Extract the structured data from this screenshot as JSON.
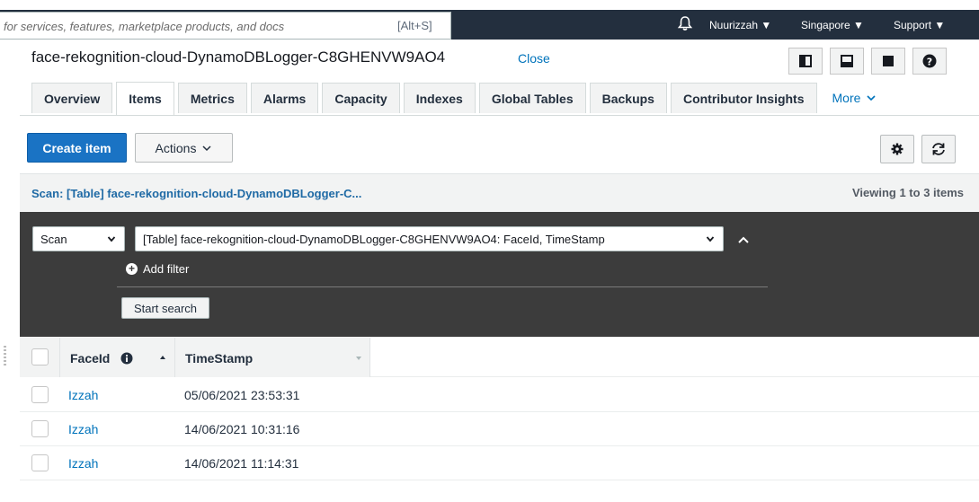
{
  "topnav": {
    "search_placeholder": "for services, features, marketplace products, and docs",
    "search_shortcut": "[Alt+S]",
    "user": "Nuurizzah ▼",
    "region": "Singapore ▼",
    "support": "Support ▼"
  },
  "header": {
    "title": "face-rekognition-cloud-DynamoDBLogger-C8GHENVW9AO4",
    "close": "Close"
  },
  "tabs": [
    {
      "label": "Overview"
    },
    {
      "label": "Items",
      "active": true
    },
    {
      "label": "Metrics"
    },
    {
      "label": "Alarms"
    },
    {
      "label": "Capacity"
    },
    {
      "label": "Indexes"
    },
    {
      "label": "Global Tables"
    },
    {
      "label": "Backups"
    },
    {
      "label": "Contributor Insights"
    }
  ],
  "more_tab": "More",
  "actions": {
    "create_item": "Create item",
    "actions": "Actions"
  },
  "scan_bar": {
    "label": "Scan: [Table] face-rekognition-cloud-DynamoDBLogger-C...",
    "viewing": "Viewing 1 to 3 items"
  },
  "query": {
    "mode": "Scan",
    "target": "[Table] face-rekognition-cloud-DynamoDBLogger-C8GHENVW9AO4: FaceId, TimeStamp",
    "add_filter": "Add filter",
    "start_search": "Start search"
  },
  "table": {
    "columns": [
      "FaceId",
      "TimeStamp"
    ],
    "rows": [
      {
        "faceid": "Izzah",
        "timestamp": "05/06/2021 23:53:31"
      },
      {
        "faceid": "Izzah",
        "timestamp": "14/06/2021 10:31:16"
      },
      {
        "faceid": "Izzah",
        "timestamp": "14/06/2021 11:14:31"
      }
    ]
  },
  "colors": {
    "nav_bg": "#232f3e",
    "primary": "#1a73c4",
    "link": "#0073bb",
    "query_panel": "#3c3c3c"
  },
  "icons": {
    "bell": "bell-icon",
    "layout_side": "layout-side-icon",
    "layout_bottom": "layout-bottom-icon",
    "layout_full": "layout-full-icon",
    "help": "help-icon",
    "settings": "gear-icon",
    "refresh": "refresh-icon"
  }
}
